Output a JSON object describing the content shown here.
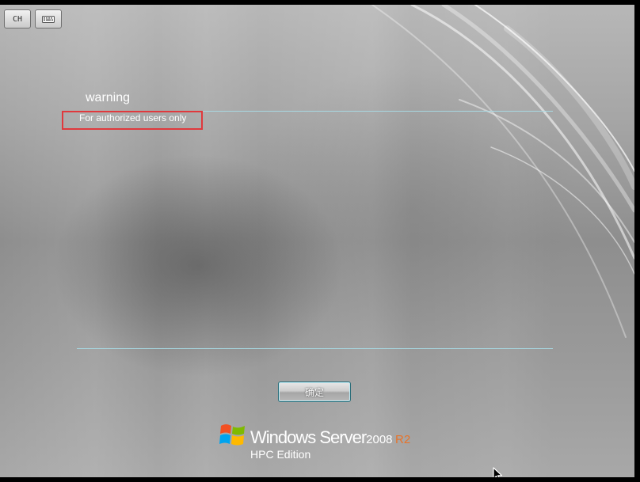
{
  "toolbar": {
    "language_label": "CH",
    "keyboard_icon": "keyboard-icon"
  },
  "dialog": {
    "title": "warning",
    "message": "For authorized users only",
    "ok_label": "确定"
  },
  "logo": {
    "product_name": "Windows Server",
    "version": "2008",
    "release": "R2",
    "edition": "HPC Edition"
  },
  "colors": {
    "divider": "#a8dbe6",
    "highlight_box": "#e0393d",
    "release_accent": "#e8732a"
  }
}
